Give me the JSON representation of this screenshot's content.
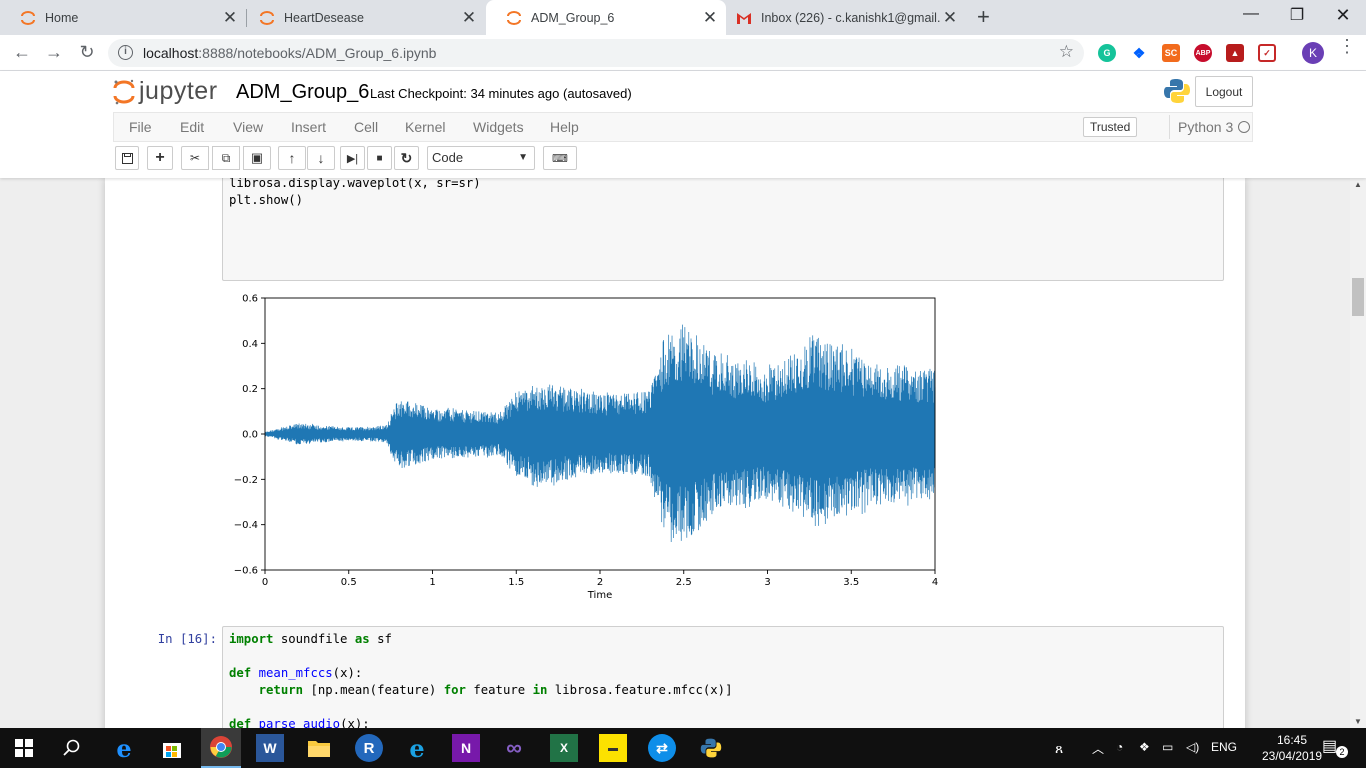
{
  "browser": {
    "tabs": [
      {
        "title": "Home",
        "icon": "jupyter-tab-icon"
      },
      {
        "title": "HeartDesease",
        "icon": "jupyter-tab-icon"
      },
      {
        "title": "ADM_Group_6",
        "icon": "jupyter-tab-icon",
        "active": true
      },
      {
        "title": "Inbox (226) - c.kanishk1@gmail.c",
        "icon": "gmail-tab-icon"
      }
    ],
    "close_glyph": "✕",
    "new_tab_glyph": "+",
    "url_host": "localhost",
    "url_path": ":8888/notebooks/ADM_Group_6.ipynb",
    "avatar_letter": "K",
    "extensions": [
      "SC",
      "ABP"
    ]
  },
  "jupyter": {
    "logo_text": "jupyter",
    "notebook_name": "ADM_Group_6",
    "checkpoint_label": "Last Checkpoint:",
    "checkpoint_time": "34 minutes ago",
    "autosave": "(autosaved)",
    "logout_label": "Logout",
    "menu": [
      "File",
      "Edit",
      "View",
      "Insert",
      "Cell",
      "Kernel",
      "Widgets",
      "Help"
    ],
    "trusted_label": "Trusted",
    "kernel_name": "Python 3",
    "cell_type": "Code"
  },
  "cells": {
    "prev_code_lines": [
      "librosa.display.waveplot(x, sr=sr)",
      "",
      "plt.show()"
    ],
    "next_prompt": "In [16]:"
  },
  "chart_data": {
    "type": "line",
    "title": "",
    "xlabel": "Time",
    "ylabel": "",
    "xlim": [
      0,
      4
    ],
    "ylim": [
      -0.6,
      0.6
    ],
    "xticks": [
      "0",
      "0.5",
      "1",
      "1.5",
      "2",
      "2.5",
      "3",
      "3.5",
      "4"
    ],
    "yticks": [
      "0.6",
      "0.4",
      "0.2",
      "0.0",
      "−0.2",
      "−0.4",
      "−0.6"
    ],
    "color": "#1f77b4",
    "envelope": [
      {
        "t": 0.0,
        "amp": 0.01
      },
      {
        "t": 0.2,
        "amp": 0.05
      },
      {
        "t": 0.5,
        "amp": 0.03
      },
      {
        "t": 0.72,
        "amp": 0.04
      },
      {
        "t": 0.8,
        "amp": 0.17
      },
      {
        "t": 1.0,
        "amp": 0.12
      },
      {
        "t": 1.4,
        "amp": 0.1
      },
      {
        "t": 1.5,
        "amp": 0.2
      },
      {
        "t": 1.65,
        "amp": 0.24
      },
      {
        "t": 2.0,
        "amp": 0.18
      },
      {
        "t": 2.3,
        "amp": 0.2
      },
      {
        "t": 2.38,
        "amp": 0.45
      },
      {
        "t": 2.5,
        "amp": 0.52
      },
      {
        "t": 2.7,
        "amp": 0.36
      },
      {
        "t": 3.0,
        "amp": 0.3
      },
      {
        "t": 3.3,
        "amp": 0.45
      },
      {
        "t": 3.6,
        "amp": 0.34
      },
      {
        "t": 4.0,
        "amp": 0.3
      }
    ]
  },
  "taskbar": {
    "language": "ENG",
    "time": "16:45",
    "date": "23/04/2019",
    "notifications": "2"
  }
}
